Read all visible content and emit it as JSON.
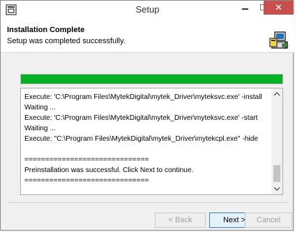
{
  "window": {
    "title": "Setup"
  },
  "header": {
    "title": "Installation Complete",
    "subtitle": "Setup was completed successfully."
  },
  "progress": {
    "value": 1.0,
    "color": "#06b025"
  },
  "log": {
    "lines": [
      "Execute: 'C:\\Program Files\\MytekDigital\\mytek_Driver\\myteksvc.exe' -install",
      "Waiting ...",
      "Execute: 'C:\\Program Files\\MytekDigital\\mytek_Driver\\myteksvc.exe' -start",
      "Waiting ...",
      "Execute: \"C:\\Program Files\\MytekDigital\\mytek_Driver\\mytekcpl.exe\" -hide",
      "",
      "==============================",
      "Preinstallation was successful. Click Next to continue.",
      "=============================="
    ]
  },
  "buttons": {
    "back": "< Back",
    "next": "Next >",
    "cancel": "Cancel"
  },
  "colors": {
    "close": "#c7504f",
    "accent": "#3c7fb1"
  },
  "icons": {
    "app": "setup-app-icon",
    "installer": "installer-computer-icon"
  }
}
